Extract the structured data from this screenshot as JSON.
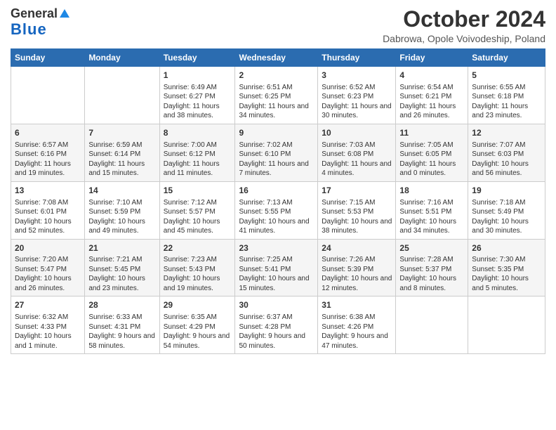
{
  "logo": {
    "line1": "General",
    "line2": "Blue"
  },
  "title": "October 2024",
  "subtitle": "Dabrowa, Opole Voivodeship, Poland",
  "days_of_week": [
    "Sunday",
    "Monday",
    "Tuesday",
    "Wednesday",
    "Thursday",
    "Friday",
    "Saturday"
  ],
  "weeks": [
    [
      {
        "day": "",
        "content": ""
      },
      {
        "day": "",
        "content": ""
      },
      {
        "day": "1",
        "content": "Sunrise: 6:49 AM\nSunset: 6:27 PM\nDaylight: 11 hours and 38 minutes."
      },
      {
        "day": "2",
        "content": "Sunrise: 6:51 AM\nSunset: 6:25 PM\nDaylight: 11 hours and 34 minutes."
      },
      {
        "day": "3",
        "content": "Sunrise: 6:52 AM\nSunset: 6:23 PM\nDaylight: 11 hours and 30 minutes."
      },
      {
        "day": "4",
        "content": "Sunrise: 6:54 AM\nSunset: 6:21 PM\nDaylight: 11 hours and 26 minutes."
      },
      {
        "day": "5",
        "content": "Sunrise: 6:55 AM\nSunset: 6:18 PM\nDaylight: 11 hours and 23 minutes."
      }
    ],
    [
      {
        "day": "6",
        "content": "Sunrise: 6:57 AM\nSunset: 6:16 PM\nDaylight: 11 hours and 19 minutes."
      },
      {
        "day": "7",
        "content": "Sunrise: 6:59 AM\nSunset: 6:14 PM\nDaylight: 11 hours and 15 minutes."
      },
      {
        "day": "8",
        "content": "Sunrise: 7:00 AM\nSunset: 6:12 PM\nDaylight: 11 hours and 11 minutes."
      },
      {
        "day": "9",
        "content": "Sunrise: 7:02 AM\nSunset: 6:10 PM\nDaylight: 11 hours and 7 minutes."
      },
      {
        "day": "10",
        "content": "Sunrise: 7:03 AM\nSunset: 6:08 PM\nDaylight: 11 hours and 4 minutes."
      },
      {
        "day": "11",
        "content": "Sunrise: 7:05 AM\nSunset: 6:05 PM\nDaylight: 11 hours and 0 minutes."
      },
      {
        "day": "12",
        "content": "Sunrise: 7:07 AM\nSunset: 6:03 PM\nDaylight: 10 hours and 56 minutes."
      }
    ],
    [
      {
        "day": "13",
        "content": "Sunrise: 7:08 AM\nSunset: 6:01 PM\nDaylight: 10 hours and 52 minutes."
      },
      {
        "day": "14",
        "content": "Sunrise: 7:10 AM\nSunset: 5:59 PM\nDaylight: 10 hours and 49 minutes."
      },
      {
        "day": "15",
        "content": "Sunrise: 7:12 AM\nSunset: 5:57 PM\nDaylight: 10 hours and 45 minutes."
      },
      {
        "day": "16",
        "content": "Sunrise: 7:13 AM\nSunset: 5:55 PM\nDaylight: 10 hours and 41 minutes."
      },
      {
        "day": "17",
        "content": "Sunrise: 7:15 AM\nSunset: 5:53 PM\nDaylight: 10 hours and 38 minutes."
      },
      {
        "day": "18",
        "content": "Sunrise: 7:16 AM\nSunset: 5:51 PM\nDaylight: 10 hours and 34 minutes."
      },
      {
        "day": "19",
        "content": "Sunrise: 7:18 AM\nSunset: 5:49 PM\nDaylight: 10 hours and 30 minutes."
      }
    ],
    [
      {
        "day": "20",
        "content": "Sunrise: 7:20 AM\nSunset: 5:47 PM\nDaylight: 10 hours and 26 minutes."
      },
      {
        "day": "21",
        "content": "Sunrise: 7:21 AM\nSunset: 5:45 PM\nDaylight: 10 hours and 23 minutes."
      },
      {
        "day": "22",
        "content": "Sunrise: 7:23 AM\nSunset: 5:43 PM\nDaylight: 10 hours and 19 minutes."
      },
      {
        "day": "23",
        "content": "Sunrise: 7:25 AM\nSunset: 5:41 PM\nDaylight: 10 hours and 15 minutes."
      },
      {
        "day": "24",
        "content": "Sunrise: 7:26 AM\nSunset: 5:39 PM\nDaylight: 10 hours and 12 minutes."
      },
      {
        "day": "25",
        "content": "Sunrise: 7:28 AM\nSunset: 5:37 PM\nDaylight: 10 hours and 8 minutes."
      },
      {
        "day": "26",
        "content": "Sunrise: 7:30 AM\nSunset: 5:35 PM\nDaylight: 10 hours and 5 minutes."
      }
    ],
    [
      {
        "day": "27",
        "content": "Sunrise: 6:32 AM\nSunset: 4:33 PM\nDaylight: 10 hours and 1 minute."
      },
      {
        "day": "28",
        "content": "Sunrise: 6:33 AM\nSunset: 4:31 PM\nDaylight: 9 hours and 58 minutes."
      },
      {
        "day": "29",
        "content": "Sunrise: 6:35 AM\nSunset: 4:29 PM\nDaylight: 9 hours and 54 minutes."
      },
      {
        "day": "30",
        "content": "Sunrise: 6:37 AM\nSunset: 4:28 PM\nDaylight: 9 hours and 50 minutes."
      },
      {
        "day": "31",
        "content": "Sunrise: 6:38 AM\nSunset: 4:26 PM\nDaylight: 9 hours and 47 minutes."
      },
      {
        "day": "",
        "content": ""
      },
      {
        "day": "",
        "content": ""
      }
    ]
  ]
}
